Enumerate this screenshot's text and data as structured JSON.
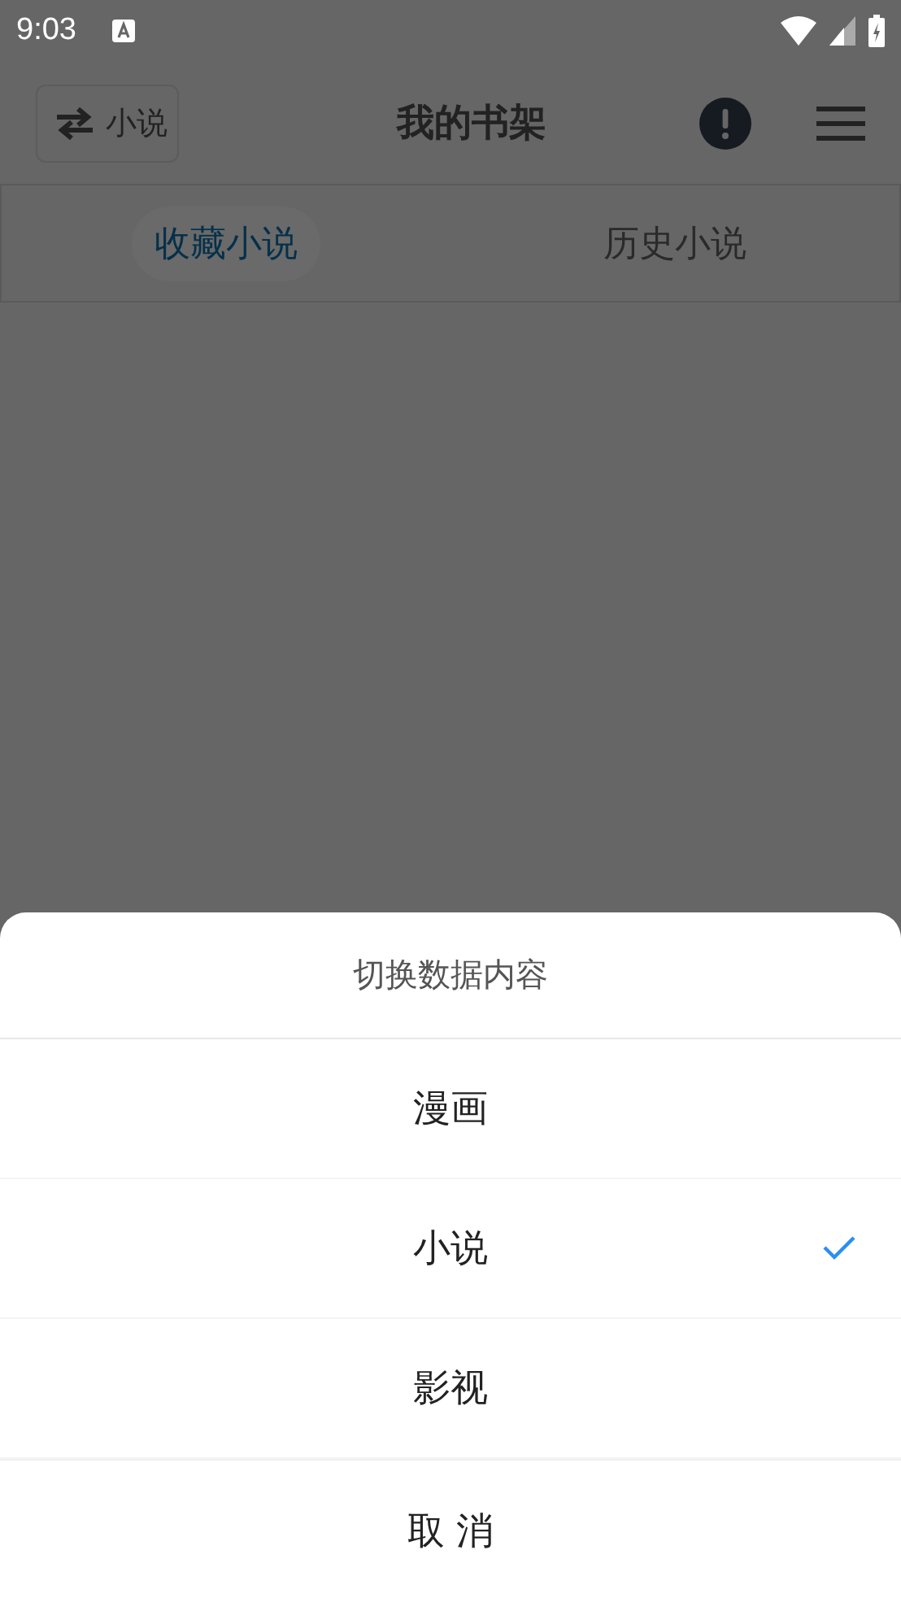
{
  "status_bar": {
    "time": "9:03"
  },
  "header": {
    "switch_button": {
      "label": "小说"
    },
    "title": "我的书架"
  },
  "tabs": [
    {
      "label": "收藏小说",
      "selected": true
    },
    {
      "label": "历史小说",
      "selected": false
    }
  ],
  "sheet": {
    "title": "切换数据内容",
    "options": [
      {
        "label": "漫画",
        "selected": false
      },
      {
        "label": "小说",
        "selected": true
      },
      {
        "label": "影视",
        "selected": false
      }
    ],
    "cancel": "取 消"
  }
}
